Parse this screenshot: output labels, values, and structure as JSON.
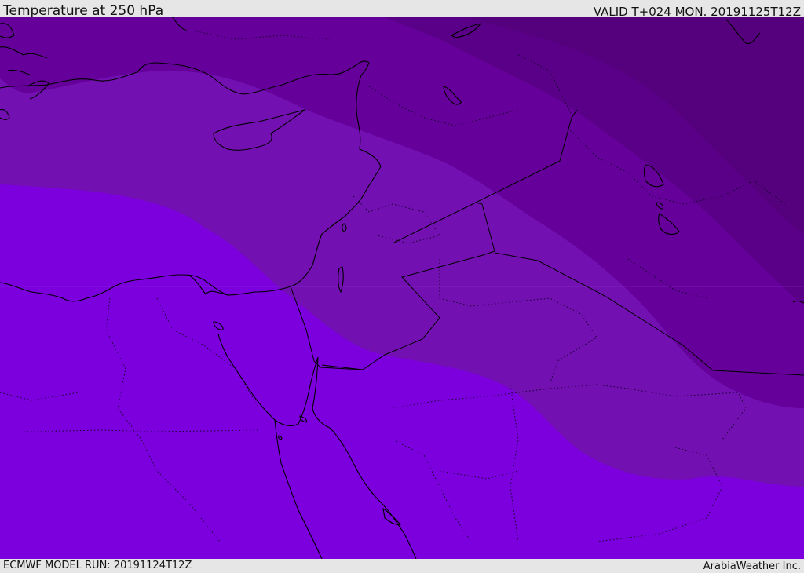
{
  "header": {
    "title": "Temperature at 250 hPa",
    "valid_time": "VALID T+024 MON. 20191125T12Z"
  },
  "footer": {
    "model_run": "ECMWF MODEL RUN: 20191124T12Z",
    "credit": "ArabiaWeather Inc."
  },
  "map": {
    "region": "Eastern Mediterranean / Middle East",
    "field": "temperature_250hPa",
    "color_bands": [
      "#7b00dd",
      "#7310b2",
      "#65009a",
      "#5a0088",
      "#55007c"
    ],
    "coastline_color": "#000000",
    "border_style": "dotted"
  }
}
